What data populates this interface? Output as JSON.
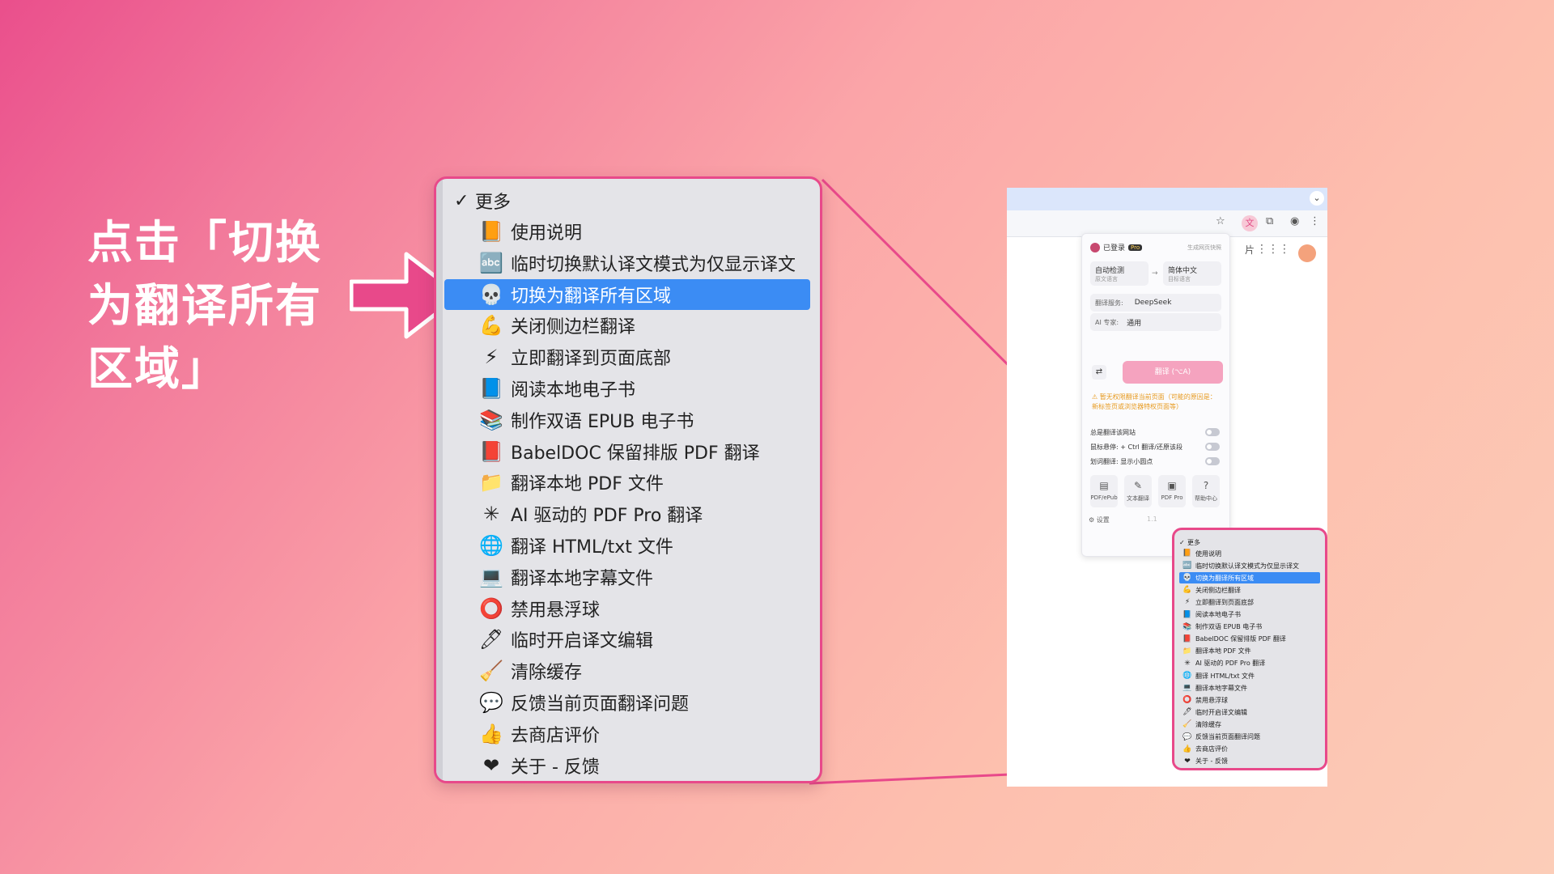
{
  "headline": "点击「切换\n为翻译所有\n区域」",
  "menu": {
    "header": {
      "check": "✓",
      "label": "更多"
    },
    "items": [
      {
        "icon": "📙",
        "icon_name": "orange-book-icon",
        "label": "使用说明"
      },
      {
        "icon": "🔤",
        "icon_name": "abc-icon",
        "label": "临时切换默认译文模式为仅显示译文"
      },
      {
        "icon": "💀",
        "icon_name": "skull-icon",
        "label": "切换为翻译所有区域",
        "selected": true
      },
      {
        "icon": "💪",
        "icon_name": "flexed-bicep-icon",
        "label": "关闭侧边栏翻译"
      },
      {
        "icon": "⚡",
        "icon_name": "lightning-icon",
        "label": "立即翻译到页面底部"
      },
      {
        "icon": "📘",
        "icon_name": "blue-book-icon",
        "label": "阅读本地电子书"
      },
      {
        "icon": "📚",
        "icon_name": "books-icon",
        "label": "制作双语 EPUB 电子书"
      },
      {
        "icon": "📕",
        "icon_name": "red-book-icon",
        "label": "BabelDOC 保留排版 PDF 翻译"
      },
      {
        "icon": "📁",
        "icon_name": "folder-icon",
        "label": "翻译本地 PDF 文件"
      },
      {
        "icon": "✳",
        "icon_name": "sparkle-icon",
        "label": "AI 驱动的 PDF Pro 翻译"
      },
      {
        "icon": "🌐",
        "icon_name": "globe-icon",
        "label": "翻译 HTML/txt 文件"
      },
      {
        "icon": "💻",
        "icon_name": "laptop-icon",
        "label": "翻译本地字幕文件"
      },
      {
        "icon": "⭕",
        "icon_name": "circle-icon",
        "label": "禁用悬浮球"
      },
      {
        "icon": "🖊",
        "icon_name": "pen-icon",
        "label": "临时开启译文编辑"
      },
      {
        "icon": "🧹",
        "icon_name": "broom-icon",
        "label": "清除缓存"
      },
      {
        "icon": "💬",
        "icon_name": "speech-bubble-icon",
        "label": "反馈当前页面翻译问题"
      },
      {
        "icon": "👍",
        "icon_name": "thumbs-up-icon",
        "label": "去商店评价"
      },
      {
        "icon": "❤",
        "icon_name": "heart-icon",
        "label": "关于 - 反馈"
      }
    ]
  },
  "popup": {
    "logged_in": "已登录",
    "pro_badge": "Pro",
    "generate_link": "生成网页快照",
    "source_lang": "自动检测",
    "source_lang_sub": "原文语言",
    "target_lang": "简体中文",
    "target_lang_sub": "目标语言",
    "service_label": "翻译服务:",
    "service_value": "DeepSeek",
    "expert_label": "AI 专家:",
    "expert_value": "通用",
    "translate_button": "翻译 (⌥A)",
    "warning": "⚠ 暂无权限翻译当前页面（可能的原因是：新标签页或浏览器特权页面等）",
    "always_translate": "总是翻译该网站",
    "hover_label": "鼠标悬停: + Ctrl 翻译/还原该段",
    "select_label": "划词翻译: 显示小圆点",
    "tools": [
      "PDF/ePub",
      "文本翻译",
      "PDF Pro",
      "帮助中心"
    ],
    "settings": "设置",
    "version": "1.1"
  },
  "browser": {
    "side_text": "片"
  },
  "colors": {
    "accent": "#e8498a",
    "selection": "#3b8cf4",
    "menu_bg": "#e4e4e8"
  }
}
